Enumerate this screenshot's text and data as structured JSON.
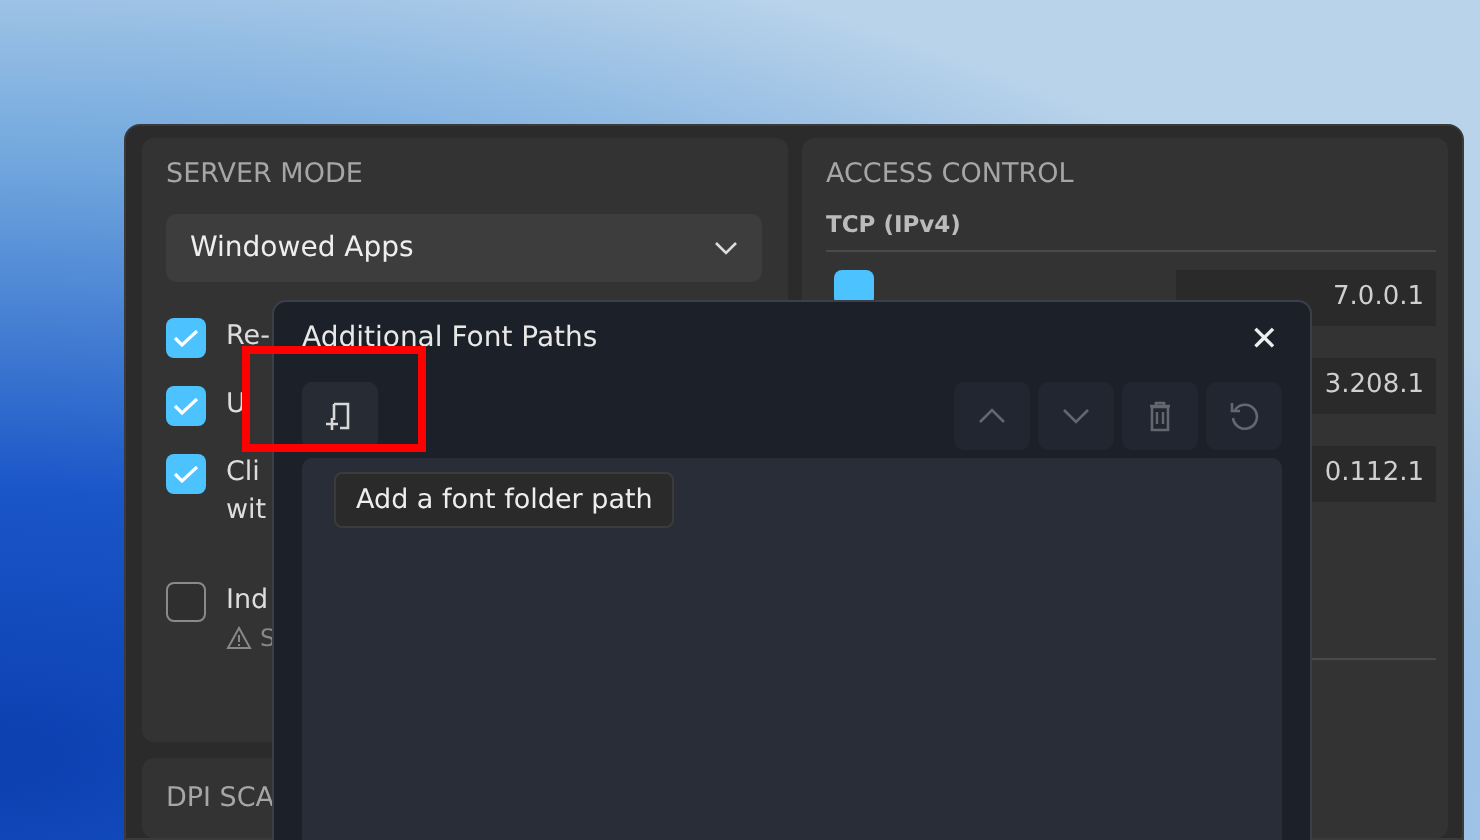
{
  "server_mode": {
    "title": "SERVER MODE",
    "dropdown": {
      "value": "Windowed Apps"
    },
    "options": [
      {
        "lines": [
          "Re-"
        ],
        "checked": true
      },
      {
        "lines": [
          "U"
        ],
        "checked": true
      },
      {
        "lines": [
          "Cli",
          "wit"
        ],
        "checked": true
      },
      {
        "lines": [
          "Ind"
        ],
        "checked": false,
        "warning": "S"
      }
    ]
  },
  "dpi_panel": {
    "title": "DPI SCA"
  },
  "access_control": {
    "title": "ACCESS CONTROL",
    "section": "TCP (IPv4)",
    "rows": [
      {
        "address": "7.0.0.1",
        "checkbox": {
          "checked": true
        }
      },
      {
        "address": "3.208.1"
      },
      {
        "address": "0.112.1"
      }
    ]
  },
  "dialog": {
    "title": "Additional Font Paths",
    "close": "✕",
    "buttons": [
      {
        "kind": "add-folder",
        "disabled": false
      },
      {
        "kind": "up",
        "disabled": true
      },
      {
        "kind": "down",
        "disabled": true
      },
      {
        "kind": "delete",
        "disabled": true
      },
      {
        "kind": "reset",
        "disabled": true
      }
    ],
    "tooltip": "Add a font folder path",
    "highlight": true
  }
}
